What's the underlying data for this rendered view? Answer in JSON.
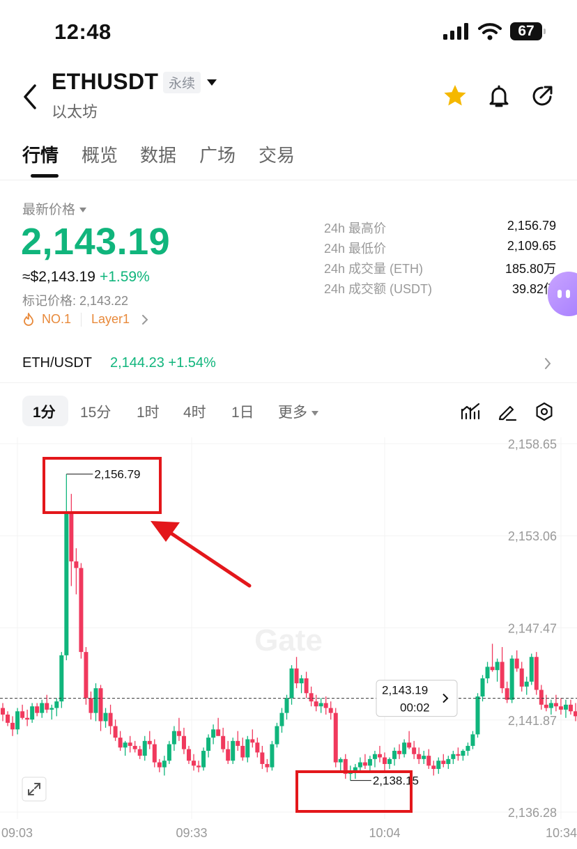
{
  "status": {
    "time": "12:48",
    "battery": "67"
  },
  "header": {
    "symbol": "ETHUSDT",
    "badge": "永续",
    "coin_name": "以太坊"
  },
  "tabs": [
    "行情",
    "概览",
    "数据",
    "广场",
    "交易"
  ],
  "price": {
    "label": "最新价格",
    "last": "2,143.19",
    "usd": "≈$2,143.19",
    "change": "+1.59%",
    "mark": "标记价格: 2,143.22",
    "rank": "NO.1",
    "category": "Layer1"
  },
  "stats": [
    {
      "label": "24h 最高价",
      "value": "2,156.79"
    },
    {
      "label": "24h 最低价",
      "value": "2,109.65"
    },
    {
      "label": "24h 成交量 (ETH)",
      "value": "185.80万"
    },
    {
      "label": "24h 成交额 (USDT)",
      "value": "39.82亿"
    }
  ],
  "spot": {
    "pair": "ETH/USDT",
    "price": "2,144.23",
    "change": "+1.54%"
  },
  "timeframes": [
    "1分",
    "15分",
    "1时",
    "4时",
    "1日",
    "更多"
  ],
  "colors": {
    "up": "#10b57c",
    "down": "#f0395d",
    "annotation": "#e3171b"
  },
  "icons": [
    "back-icon",
    "star-icon",
    "bell-icon",
    "share-icon",
    "fire-icon",
    "chevron-right-icon",
    "indicator-icon",
    "pen-icon",
    "settings-icon",
    "expand-icon"
  ],
  "chart_data": {
    "type": "candlestick",
    "interval": "1分",
    "y_ticks": [
      "2,158.65",
      "2,153.06",
      "2,147.47",
      "2,141.87",
      "2,136.28"
    ],
    "x_ticks": [
      "09:03",
      "09:33",
      "10:04",
      "10:34"
    ],
    "ylim": [
      2136.28,
      2158.65
    ],
    "current_price": {
      "value": "2,143.19",
      "countdown": "00:02"
    },
    "high_label": "2,156.79",
    "low_label": "2,138.15",
    "watermark": "Gate",
    "candles": [
      [
        2142.6,
        2142.9,
        2141.8,
        2142.2
      ],
      [
        2142.2,
        2142.4,
        2141.5,
        2141.7
      ],
      [
        2141.7,
        2142.1,
        2140.9,
        2141.3
      ],
      [
        2141.3,
        2142.6,
        2141.0,
        2142.4
      ],
      [
        2142.4,
        2142.8,
        2141.9,
        2142.0
      ],
      [
        2142.0,
        2142.5,
        2141.5,
        2141.9
      ],
      [
        2141.9,
        2142.9,
        2141.7,
        2142.7
      ],
      [
        2142.7,
        2142.9,
        2142.1,
        2142.3
      ],
      [
        2142.3,
        2143.1,
        2142.0,
        2142.9
      ],
      [
        2142.9,
        2143.4,
        2142.3,
        2142.5
      ],
      [
        2142.5,
        2142.8,
        2141.9,
        2142.6
      ],
      [
        2142.6,
        2143.2,
        2142.1,
        2143.0
      ],
      [
        2143.0,
        2146.0,
        2142.6,
        2145.8
      ],
      [
        2145.8,
        2156.8,
        2145.5,
        2154.5
      ],
      [
        2154.5,
        2155.6,
        2150.0,
        2151.5
      ],
      [
        2151.5,
        2152.3,
        2149.5,
        2151.1
      ],
      [
        2151.1,
        2151.4,
        2145.6,
        2146.0
      ],
      [
        2146.0,
        2146.3,
        2142.8,
        2143.2
      ],
      [
        2143.2,
        2143.6,
        2141.9,
        2142.3
      ],
      [
        2142.3,
        2144.1,
        2141.8,
        2143.8
      ],
      [
        2143.8,
        2144.0,
        2141.2,
        2141.8
      ],
      [
        2141.8,
        2142.6,
        2141.4,
        2142.3
      ],
      [
        2142.3,
        2142.8,
        2141.0,
        2141.5
      ],
      [
        2141.5,
        2141.9,
        2140.6,
        2140.8
      ],
      [
        2140.8,
        2141.2,
        2140.0,
        2140.2
      ],
      [
        2140.2,
        2140.6,
        2139.7,
        2140.5
      ],
      [
        2140.5,
        2140.9,
        2139.9,
        2140.3
      ],
      [
        2140.3,
        2140.6,
        2139.9,
        2140.1
      ],
      [
        2140.1,
        2140.3,
        2139.5,
        2139.7
      ],
      [
        2139.7,
        2140.9,
        2139.4,
        2140.6
      ],
      [
        2140.6,
        2141.2,
        2140.1,
        2140.4
      ],
      [
        2140.4,
        2140.7,
        2139.0,
        2139.3
      ],
      [
        2139.3,
        2139.5,
        2138.7,
        2139.0
      ],
      [
        2139.0,
        2139.7,
        2138.5,
        2139.4
      ],
      [
        2139.4,
        2140.6,
        2139.2,
        2140.4
      ],
      [
        2140.4,
        2141.5,
        2140.0,
        2141.2
      ],
      [
        2141.2,
        2142.0,
        2140.6,
        2140.9
      ],
      [
        2140.9,
        2141.4,
        2139.8,
        2140.1
      ],
      [
        2140.1,
        2140.3,
        2139.2,
        2139.4
      ],
      [
        2139.4,
        2139.8,
        2138.8,
        2139.1
      ],
      [
        2139.1,
        2139.4,
        2138.7,
        2139.0
      ],
      [
        2139.0,
        2140.2,
        2138.8,
        2140.0
      ],
      [
        2140.0,
        2141.0,
        2139.6,
        2140.8
      ],
      [
        2140.8,
        2141.6,
        2140.4,
        2141.3
      ],
      [
        2141.3,
        2142.0,
        2140.9,
        2140.9
      ],
      [
        2140.9,
        2141.4,
        2139.9,
        2140.1
      ],
      [
        2140.1,
        2140.6,
        2139.2,
        2139.4
      ],
      [
        2139.4,
        2140.8,
        2139.2,
        2140.6
      ],
      [
        2140.6,
        2141.2,
        2140.0,
        2140.3
      ],
      [
        2140.3,
        2140.8,
        2139.4,
        2139.6
      ],
      [
        2139.6,
        2140.9,
        2139.3,
        2140.7
      ],
      [
        2140.7,
        2141.3,
        2140.2,
        2140.5
      ],
      [
        2140.5,
        2140.8,
        2139.6,
        2139.9
      ],
      [
        2139.9,
        2140.3,
        2138.9,
        2139.2
      ],
      [
        2139.2,
        2139.5,
        2138.7,
        2139.0
      ],
      [
        2139.0,
        2140.6,
        2138.8,
        2140.4
      ],
      [
        2140.4,
        2141.7,
        2140.2,
        2141.5
      ],
      [
        2141.5,
        2142.6,
        2141.1,
        2142.3
      ],
      [
        2142.3,
        2143.4,
        2141.9,
        2143.2
      ],
      [
        2143.2,
        2145.2,
        2142.8,
        2145.0
      ],
      [
        2145.0,
        2145.7,
        2143.8,
        2144.1
      ],
      [
        2144.1,
        2144.6,
        2143.5,
        2144.4
      ],
      [
        2144.4,
        2144.8,
        2143.2,
        2143.5
      ],
      [
        2143.5,
        2143.9,
        2142.7,
        2143.0
      ],
      [
        2143.0,
        2143.4,
        2142.4,
        2142.7
      ],
      [
        2142.7,
        2143.2,
        2142.3,
        2142.9
      ],
      [
        2142.9,
        2143.3,
        2142.2,
        2142.6
      ],
      [
        2142.6,
        2143.0,
        2141.9,
        2142.3
      ],
      [
        2142.3,
        2142.6,
        2139.0,
        2139.3
      ],
      [
        2139.3,
        2139.6,
        2138.7,
        2139.5
      ],
      [
        2139.5,
        2139.8,
        2138.3,
        2138.6
      ],
      [
        2138.6,
        2139.1,
        2138.2,
        2138.7
      ],
      [
        2138.7,
        2139.2,
        2138.3,
        2139.0
      ],
      [
        2139.0,
        2139.6,
        2138.7,
        2139.3
      ],
      [
        2139.3,
        2139.8,
        2138.9,
        2139.1
      ],
      [
        2139.1,
        2139.7,
        2138.8,
        2139.5
      ],
      [
        2139.5,
        2140.0,
        2139.0,
        2139.8
      ],
      [
        2139.8,
        2140.3,
        2139.3,
        2139.6
      ],
      [
        2139.6,
        2139.9,
        2138.8,
        2139.2
      ],
      [
        2139.2,
        2139.6,
        2138.9,
        2139.5
      ],
      [
        2139.5,
        2140.2,
        2139.1,
        2140.0
      ],
      [
        2140.0,
        2140.4,
        2139.5,
        2139.8
      ],
      [
        2139.8,
        2140.7,
        2139.6,
        2140.5
      ],
      [
        2140.5,
        2141.2,
        2140.1,
        2140.2
      ],
      [
        2140.2,
        2140.6,
        2139.5,
        2139.8
      ],
      [
        2139.8,
        2140.2,
        2139.2,
        2139.5
      ],
      [
        2139.5,
        2140.0,
        2139.2,
        2139.7
      ],
      [
        2139.7,
        2140.1,
        2138.9,
        2139.1
      ],
      [
        2139.1,
        2139.4,
        2138.5,
        2138.9
      ],
      [
        2138.9,
        2139.6,
        2138.6,
        2139.4
      ],
      [
        2139.4,
        2139.8,
        2139.0,
        2139.2
      ],
      [
        2139.2,
        2139.7,
        2138.9,
        2139.5
      ],
      [
        2139.5,
        2140.0,
        2139.2,
        2139.8
      ],
      [
        2139.8,
        2140.2,
        2139.4,
        2139.7
      ],
      [
        2139.7,
        2140.1,
        2139.4,
        2140.0
      ],
      [
        2140.0,
        2140.5,
        2139.7,
        2140.3
      ],
      [
        2140.3,
        2141.2,
        2140.1,
        2141.0
      ],
      [
        2141.0,
        2143.5,
        2140.8,
        2143.3
      ],
      [
        2143.3,
        2144.6,
        2143.0,
        2144.4
      ],
      [
        2144.4,
        2145.4,
        2144.1,
        2145.1
      ],
      [
        2145.1,
        2146.5,
        2144.8,
        2144.9
      ],
      [
        2144.9,
        2145.6,
        2144.2,
        2145.4
      ],
      [
        2145.4,
        2146.3,
        2143.5,
        2143.8
      ],
      [
        2143.8,
        2144.2,
        2142.9,
        2143.1
      ],
      [
        2143.1,
        2145.8,
        2142.9,
        2145.6
      ],
      [
        2145.6,
        2146.1,
        2144.8,
        2145.0
      ],
      [
        2145.0,
        2145.4,
        2143.6,
        2143.9
      ],
      [
        2143.9,
        2144.5,
        2143.4,
        2144.2
      ],
      [
        2144.2,
        2145.9,
        2144.0,
        2145.7
      ],
      [
        2145.7,
        2146.0,
        2143.4,
        2143.7
      ],
      [
        2143.7,
        2144.0,
        2142.5,
        2142.8
      ],
      [
        2142.8,
        2143.4,
        2142.4,
        2142.6
      ],
      [
        2142.6,
        2143.1,
        2142.2,
        2142.9
      ],
      [
        2142.9,
        2143.4,
        2142.4,
        2142.7
      ],
      [
        2142.7,
        2143.2,
        2142.2,
        2142.5
      ],
      [
        2142.5,
        2143.1,
        2142.0,
        2142.8
      ],
      [
        2142.8,
        2143.1,
        2142.2,
        2142.4
      ],
      [
        2142.4,
        2142.9,
        2141.8,
        2142.1
      ]
    ]
  }
}
